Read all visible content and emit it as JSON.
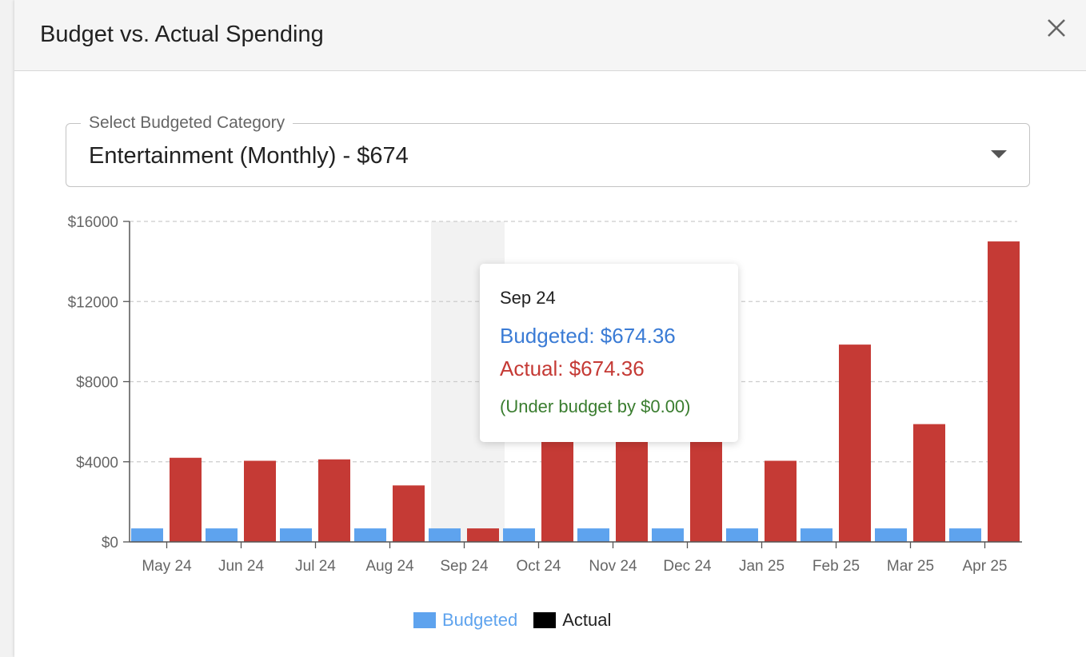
{
  "dialog": {
    "title": "Budget vs. Actual Spending",
    "close_icon": "close-icon"
  },
  "select": {
    "label": "Select Budgeted Category",
    "value": "Entertainment (Monthly) - $674",
    "arrow_icon": "dropdown-arrow-icon"
  },
  "tooltip": {
    "title": "Sep 24",
    "budgeted": "Budgeted: $674.36",
    "actual": "Actual: $674.36",
    "note": "(Under budget by $0.00)"
  },
  "legend": {
    "budgeted_label": "Budgeted",
    "actual_label": "Actual"
  },
  "colors": {
    "budgeted": "#5ea3ee",
    "actual": "#c53a35",
    "legend_actual_swatch": "#000000",
    "legend_budgeted_text": "#5ea3ee",
    "tooltip_budgeted_text": "#3a7bd5",
    "tooltip_note_text": "#3a7d2f",
    "highlight_band": "#f2f2f2"
  },
  "chart_data": {
    "type": "bar",
    "categories": [
      "May 24",
      "Jun 24",
      "Jul 24",
      "Aug 24",
      "Sep 24",
      "Oct 24",
      "Nov 24",
      "Dec 24",
      "Jan 25",
      "Feb 25",
      "Mar 25",
      "Apr 25"
    ],
    "series": [
      {
        "name": "Budgeted",
        "values": [
          674.36,
          674.36,
          674.36,
          674.36,
          674.36,
          674.36,
          674.36,
          674.36,
          674.36,
          674.36,
          674.36,
          674.36
        ]
      },
      {
        "name": "Actual",
        "values": [
          4200,
          4050,
          4120,
          2820,
          674.36,
          5200,
          5200,
          5200,
          4050,
          9850,
          5880,
          15000
        ]
      }
    ],
    "y_ticks": [
      0,
      4000,
      8000,
      12000,
      16000
    ],
    "y_tick_labels": [
      "$0",
      "$4000",
      "$8000",
      "$12000",
      "$16000"
    ],
    "ylim": [
      0,
      16000
    ],
    "grid": true,
    "highlighted_category": "Sep 24",
    "legend_position": "bottom-center"
  }
}
